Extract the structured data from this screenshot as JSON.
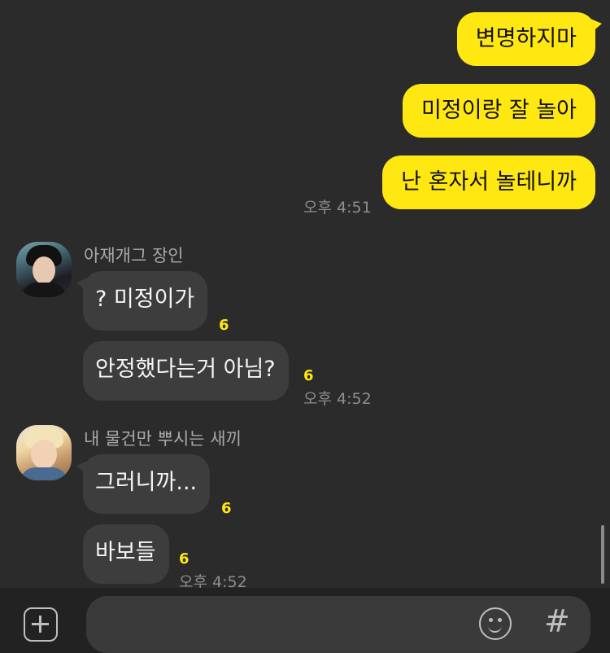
{
  "messages_out": [
    {
      "text": "변명하지마"
    },
    {
      "text": "미정이랑 잘 놀아"
    },
    {
      "text": "난 혼자서 놀테니까"
    }
  ],
  "out_time": "오후 4:51",
  "sender1": {
    "name": "아재개그 장인",
    "avatar_icon": "profile-photo-jin",
    "messages": [
      {
        "text": "? 미정이가",
        "unread": "6"
      },
      {
        "text": "안정했다는거 아님?",
        "unread": "6"
      }
    ],
    "time": "오후 4:52"
  },
  "sender2": {
    "name": "내 물건만 뿌시는 새끼",
    "avatar_icon": "profile-photo-suga",
    "messages": [
      {
        "text": "그러니까...",
        "unread": "6"
      },
      {
        "text": "바보들",
        "unread": "6"
      }
    ],
    "time": "오후 4:52"
  },
  "input_bar": {
    "placeholder": "",
    "plus_icon": "plus-square-icon",
    "emoji_icon": "smiley-icon",
    "hash_label": "#"
  },
  "colors": {
    "background": "#2b2b2b",
    "outgoing_bubble": "#ffe812",
    "incoming_bubble": "#3d3d3d",
    "unread_count": "#ffe812"
  }
}
